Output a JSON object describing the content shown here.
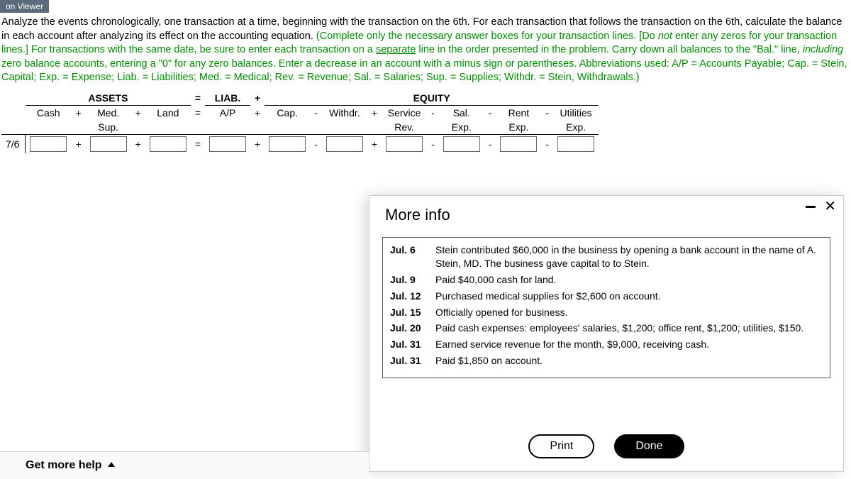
{
  "tab_label": "on Viewer",
  "instructions": {
    "black1": "Analyze the events chronologically, one transaction at a time, beginning with the transaction on the 6th. For each transaction that follows the transaction on the 6th, calculate the balance in each account after analyzing its effect on the accounting equation. ",
    "green1": "(Complete only the necessary answer boxes for your transaction lines. [Do ",
    "green_not": "not",
    "green2": " enter any zeros for your transaction lines.] For transactions with the same date, be sure to enter each transaction on a ",
    "green_sep": "separate",
    "green3": " line in the order presented in the problem. Carry down all balances to the \"Bal.\" line, ",
    "green_incl": "including",
    "green4": " zero balance accounts, entering a \"0\" for any zero balances. Enter a decrease in an account with a minus sign or parentheses. Abbreviations used: A/P = Accounts Payable; Cap. = Stein, Capital; Exp. = Expense; Liab. = Liabilities; Med. = Medical; Rev. = Revenue; Sal. = Salaries; Sup. = Supplies; Withdr. = Stein, Withdrawals.)"
  },
  "headers": {
    "assets": "ASSETS",
    "eq1": "=",
    "liab": "LIAB.",
    "plus": "+",
    "equity": "EQUITY",
    "cash": "Cash",
    "med": "Med.",
    "sup": "Sup.",
    "land": "Land",
    "ap": "A/P",
    "cap": "Cap.",
    "withdr": "Withdr.",
    "service": "Service",
    "rev": "Rev.",
    "sal": "Sal.",
    "exp": "Exp.",
    "rent": "Rent",
    "util": "Utilities",
    "minus": "-"
  },
  "row_date": "7/6",
  "modal": {
    "title": "More info",
    "rows": [
      {
        "date": "Jul. 6",
        "text": "Stein contributed $60,000 in the business by opening a bank account in the name of A. Stein, MD. The business gave capital to to Stein."
      },
      {
        "date": "Jul. 9",
        "text": "Paid $40,000 cash for land."
      },
      {
        "date": "Jul. 12",
        "text": "Purchased medical supplies for $2,600 on account."
      },
      {
        "date": "Jul. 15",
        "text": "Officially opened for business."
      },
      {
        "date": "Jul. 20",
        "text": "Paid cash expenses: employees' salaries, $1,200; office rent, $1,200; utilities, $150."
      },
      {
        "date": "Jul. 31",
        "text": "Earned service revenue for the month, $9,000, receiving cash."
      },
      {
        "date": "Jul. 31",
        "text": "Paid $1,850 on account."
      }
    ],
    "print": "Print",
    "done": "Done"
  },
  "help": "Get more help"
}
